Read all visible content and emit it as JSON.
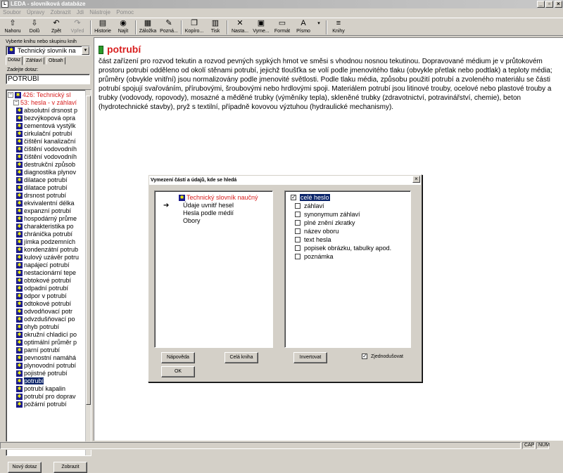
{
  "window": {
    "title": "LEDA - slovníková databáze",
    "icon_text": "L"
  },
  "menu": [
    "Soubor",
    "Úpravy",
    "Zobrazit",
    "Jdi",
    "Nástroje",
    "Pomoc"
  ],
  "toolbar": {
    "back": "Nahoru",
    "down": "Dolů",
    "back2": "Zpět",
    "forward": "Vpřed",
    "history": "Historie",
    "find": "Najít",
    "bookmark": "Záložka",
    "note": "Pozná...",
    "copy": "Kopíro...",
    "print": "Tisk",
    "settings": "Nasta...",
    "define": "Vyme...",
    "format": "Formát",
    "font": "Písmo",
    "books": "Knihy"
  },
  "left": {
    "book_prompt": "Vyberte knihu nebo skupinu knih",
    "book_selected": "Technický slovník na",
    "tabs": [
      "Dotaz",
      "Záhlaví",
      "Obsah"
    ],
    "query_prompt": "Zadejte dotaz:",
    "query_value": "POTRUBÍ",
    "tree_root": "426: Technický sl",
    "tree_sub": "53: hesla - v záhlaví",
    "tree_items": [
      "absolutní drsnost p",
      "bezvýkopová opra",
      "cementová vystýlk",
      "cirkulační potrubí",
      "čištění kanalizační",
      "čištění vodovodníh",
      "čištění vodovodníh",
      "destrukční způsob",
      "diagnostika plynov",
      "dilatace potrubí",
      "dilatace potrubí",
      "drsnost potrubí",
      "ekvivalentní délka",
      "expanzní potrubí",
      "hospodárný průme",
      "charakteristika po",
      "chránička potrubí",
      "jímka podzemních",
      "kondenzátní potrub",
      "kulový uzávěr potru",
      "napájecí potrubí",
      "nestacionární tepe",
      "obtokové potrubí",
      "odpadní potrubí",
      "odpor v potrubí",
      "odtokové potrubí",
      "odvodňovací potr",
      "odvzdušňovací po",
      "ohyb potrubí",
      "okružní chladicí po",
      "optimální průměr p",
      "parní potrubí",
      "pevnostní namáhá",
      "plynovodní potrubí",
      "pojistné potrubí",
      "potrubí",
      "potrubí kapalin",
      "potrubí pro doprav",
      "požární potrubí"
    ],
    "selected_index": 35,
    "new_query_btn": "Nový dotaz",
    "show_btn": "Zobrazit"
  },
  "doc": {
    "title": "potrubí",
    "text": "část zařízení pro rozvod tekutin a rozvod pevných sypkých hmot ve směsi s vhodnou nosnou tekutinou. Dopravované médium je v průtokovém prostoru potrubí odděleno od okolí stěnami potrubí, jejichž tloušťka se volí podle jmenovitého tlaku (obvykle přetlak nebo podtlak) a teploty média; průměry (obvykle vnitřní) jsou normalizovány podle jmenovité světlosti. Podle tlaku média, způsobu použití potrubí a zvoleného materiálu se části potrubí spojují svařováním, přírubovými, šroubovými nebo hrdlovými spoji. Materiálem potrubí jsou litinové trouby, ocelové nebo plastové trouby a trubky (vodovody, ropovody), mosazné a měděné trubky (výměníky tepla), skleněné trubky (zdravotnictví, potravinářství, chemie), beton (hydrotechnické stavby), pryž s textilní, případně kovovou výztuhou (hydraulické mechanismy)."
  },
  "dialog": {
    "title": "Vymezení částí a údajů, kde se hledá",
    "close": "×",
    "left_items": [
      "Technický slovník naučný",
      "Údaje uvnitř hesel",
      "Hesla podle médií",
      "Obory"
    ],
    "right_items": [
      {
        "label": "celé heslo",
        "checked": true
      },
      {
        "label": "záhlaví",
        "checked": false
      },
      {
        "label": "synonymum záhlaví",
        "checked": false
      },
      {
        "label": "plné znění zkratky",
        "checked": false
      },
      {
        "label": "název oboru",
        "checked": false
      },
      {
        "label": "text hesla",
        "checked": false
      },
      {
        "label": "popisek obrázku, tabulky apod.",
        "checked": false
      },
      {
        "label": "poznámka",
        "checked": false
      }
    ],
    "help_btn": "Nápověda",
    "whole_book_btn": "Celá kniha",
    "invert_btn": "Invertovat",
    "simplified_label": "Zjednodušovat",
    "simplified_checked": true,
    "ok_btn": "OK"
  },
  "status": {
    "caps": "CAP",
    "num": "NUM"
  }
}
